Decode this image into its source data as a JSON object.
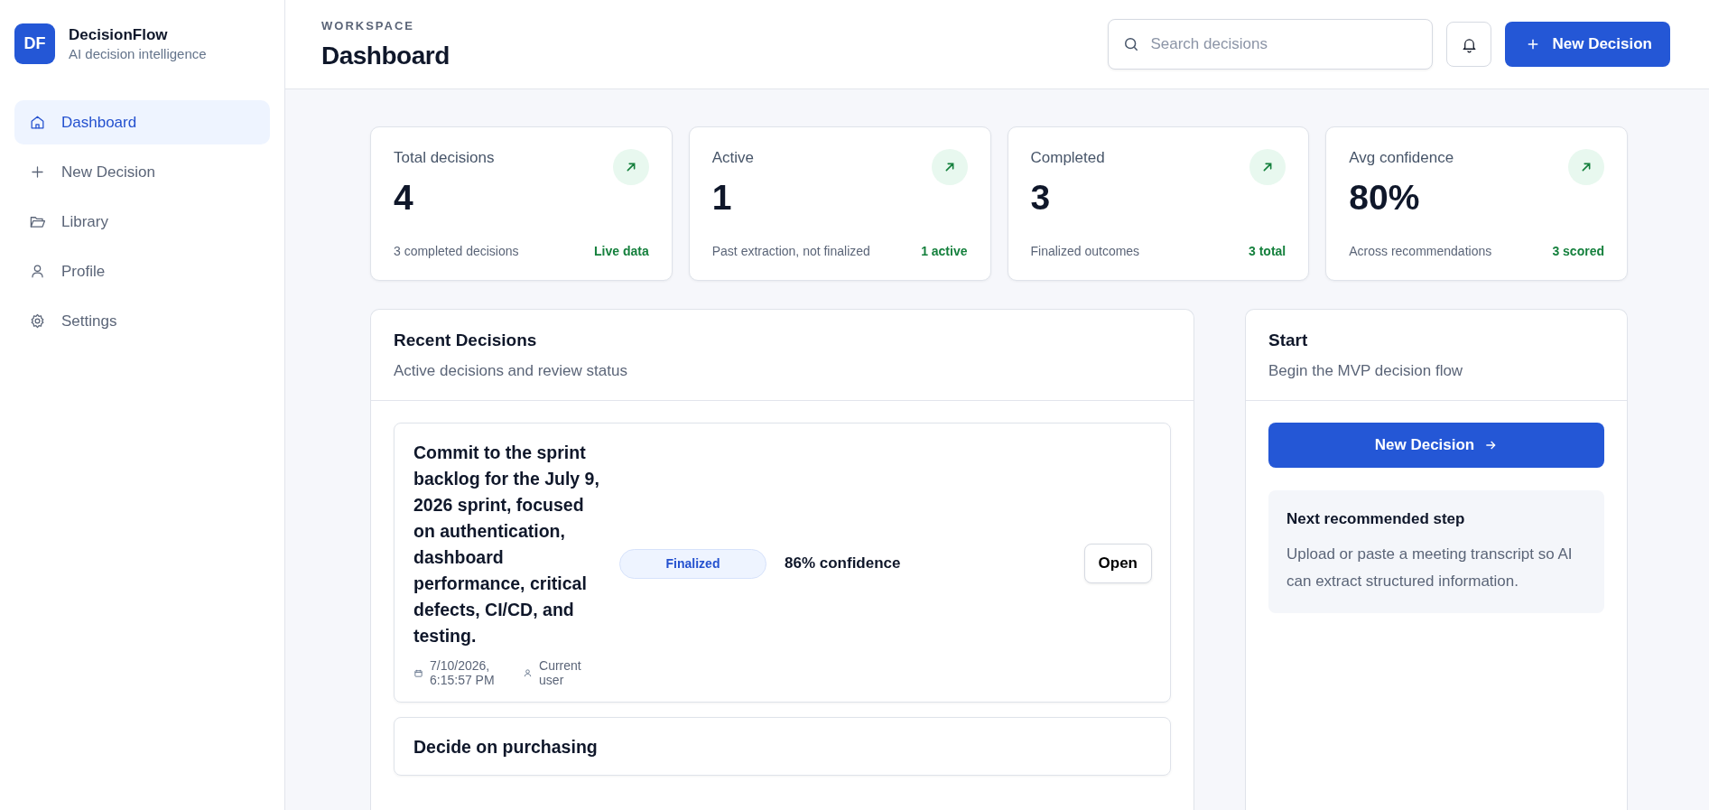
{
  "brand": {
    "logo": "DF",
    "name": "DecisionFlow",
    "tagline": "AI decision intelligence"
  },
  "sidebar": {
    "items": [
      {
        "label": "Dashboard",
        "selected": true
      },
      {
        "label": "New Decision",
        "selected": false
      },
      {
        "label": "Library",
        "selected": false
      },
      {
        "label": "Profile",
        "selected": false
      },
      {
        "label": "Settings",
        "selected": false
      }
    ]
  },
  "header": {
    "eyebrow": "WORKSPACE",
    "title": "Dashboard",
    "search": {
      "placeholder": "Search decisions"
    },
    "new_button": "New Decision"
  },
  "stats": [
    {
      "label": "Total decisions",
      "value": "4",
      "note": "3 completed decisions",
      "tag": "Live data"
    },
    {
      "label": "Active",
      "value": "1",
      "note": "Past extraction, not finalized",
      "tag": "1 active"
    },
    {
      "label": "Completed",
      "value": "3",
      "note": "Finalized outcomes",
      "tag": "3 total"
    },
    {
      "label": "Avg confidence",
      "value": "80%",
      "note": "Across recommendations",
      "tag": "3 scored"
    }
  ],
  "recent": {
    "title": "Recent Decisions",
    "subtitle": "Active decisions and review status",
    "items": [
      {
        "title": "Commit to the sprint backlog for the July 9, 2026 sprint, focused on authentication, dashboard performance, critical defects, CI/CD, and testing.",
        "status": "Finalized",
        "confidence": "86% confidence",
        "date": "7/10/2026, 6:15:57 PM",
        "owner": "Current user",
        "action": "Open"
      },
      {
        "title": "Decide on purchasing"
      }
    ]
  },
  "start": {
    "title": "Start",
    "subtitle": "Begin the MVP decision flow",
    "button": "New Decision",
    "next": {
      "title": "Next recommended step",
      "text": "Upload or paste a meeting transcript so AI can extract structured information."
    }
  }
}
